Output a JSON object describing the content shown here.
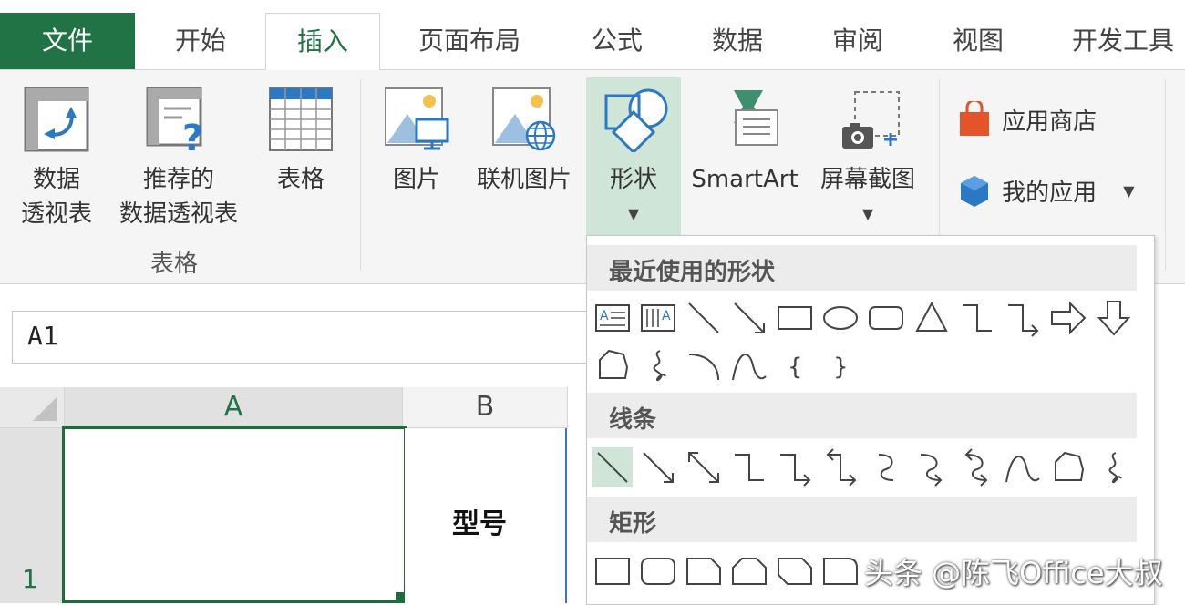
{
  "tabs": [
    "文件",
    "开始",
    "插入",
    "页面布局",
    "公式",
    "数据",
    "审阅",
    "视图",
    "开发工具"
  ],
  "ribbon": {
    "pivot_table": [
      "数据",
      "透视表"
    ],
    "recommended_pivot": [
      "推荐的",
      "数据透视表"
    ],
    "table": "表格",
    "tables_group": "表格",
    "picture": "图片",
    "online_picture": "联机图片",
    "shapes": "形状",
    "smartart": "SmartArt",
    "screenshot": "屏幕截图",
    "app_store": "应用商店",
    "my_apps": "我的应用"
  },
  "namebox": "A1",
  "grid": {
    "col_a": "A",
    "col_b": "B",
    "row_1": "1",
    "cell_b1": "型号"
  },
  "shapes_menu": {
    "recent": "最近使用的形状",
    "lines": "线条",
    "rectangles": "矩形"
  },
  "watermark": "头条 @陈飞Office大叔",
  "colors": {
    "accent": "#217346",
    "selection": "#cfe5d8"
  }
}
